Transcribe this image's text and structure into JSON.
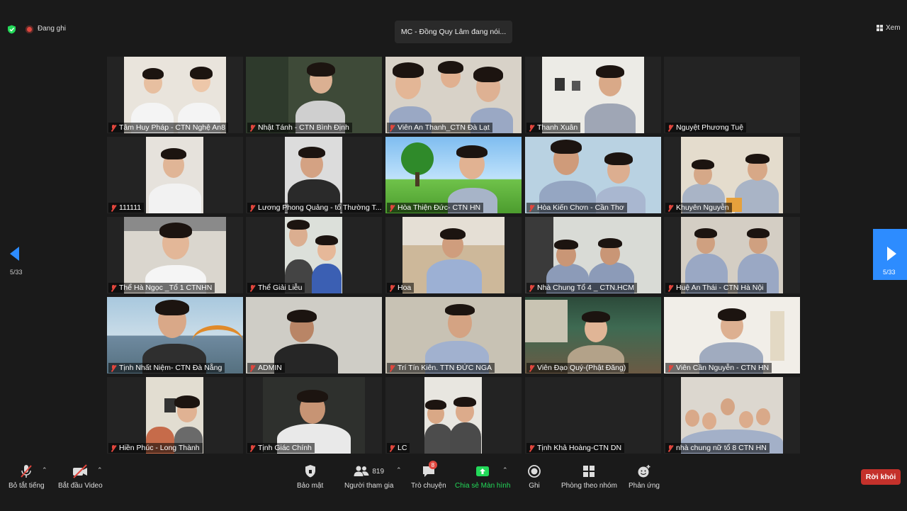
{
  "topbar": {
    "recording_label": "Đang ghi",
    "active_speaker": "MC - Đồng Quy Lâm đang nói...",
    "view_label": "Xem"
  },
  "pagination": {
    "left_count": "5/33",
    "right_count": "5/33"
  },
  "participants": [
    {
      "name": "Tâm Huy Pháp - CTN Nghệ An8",
      "muted": true
    },
    {
      "name": "Nhật Tánh - CTN Bình Định",
      "muted": true
    },
    {
      "name": "Viên An Thanh_CTN Đà Lạt",
      "muted": true
    },
    {
      "name": "Thanh Xuân",
      "muted": true
    },
    {
      "name": "Nguyệt Phương Tuệ",
      "muted": true
    },
    {
      "name": "111111",
      "muted": true
    },
    {
      "name": "Lương Phong Quảng - tổ Thường T...",
      "muted": true
    },
    {
      "name": "Hòa Thiện Đức- CTN HN",
      "muted": true
    },
    {
      "name": "Hòa Kiến Chơn - Cần Thơ",
      "muted": true
    },
    {
      "name": "Khuyên Nguyễn",
      "muted": true
    },
    {
      "name": "Thể Hà Ngọc _Tổ 1 CTNHN",
      "muted": true
    },
    {
      "name": "Thể Giải Liễu",
      "muted": true
    },
    {
      "name": "Hoa",
      "muted": true
    },
    {
      "name": "Nhà Chung Tổ 4 _ CTN.HCM",
      "muted": true
    },
    {
      "name": "Huệ An Thái - CTN Hà Nội",
      "muted": true
    },
    {
      "name": "Tịnh Nhất Niệm- CTN Đà Nẵng",
      "muted": true
    },
    {
      "name": "ADMIN",
      "muted": true
    },
    {
      "name": "Trí Tín Kiên. TTN ĐỨC NGA",
      "muted": true
    },
    {
      "name": "Viên Đạo Quý-(Phật Đăng)",
      "muted": true
    },
    {
      "name": "Viên Cần Nguyễn - CTN HN",
      "muted": true
    },
    {
      "name": "Hiền Phúc - Long Thành",
      "muted": true
    },
    {
      "name": "Tịnh Giác Chính",
      "muted": true
    },
    {
      "name": "LC",
      "muted": true
    },
    {
      "name": "Tịnh Khả Hoàng-CTN DN",
      "muted": true
    },
    {
      "name": "nhà chung nữ tổ 8 CTN HN",
      "muted": true
    }
  ],
  "toolbar": {
    "mute_all": "Bỏ tắt tiếng",
    "start_video": "Bắt đầu Video",
    "security": "Bảo mật",
    "participants": "Người tham gia",
    "participants_count": "819",
    "chat": "Trò chuyện",
    "chat_badge": "8",
    "share_screen": "Chia sẻ Màn hình",
    "record": "Ghi",
    "breakout": "Phòng theo nhóm",
    "reactions": "Phản ứng",
    "leave": "Rời khỏi"
  },
  "colors": {
    "accent": "#2d8cff",
    "share_green": "#23d959",
    "leave_red": "#c4312b",
    "muted_red": "#e0463d"
  }
}
